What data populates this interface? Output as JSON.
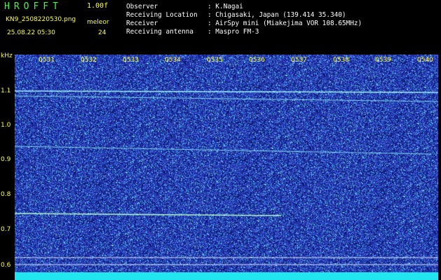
{
  "header": {
    "app_title": "HROFFT",
    "version": "1.00f",
    "filename": "KN9_2508220530.png",
    "datetime": "25.08.22 05:30",
    "mode_label": "meleor",
    "mode_value": "24",
    "info": [
      {
        "key": "Observer",
        "value": ": K.Nagai"
      },
      {
        "key": "Receiving Location",
        "value": ": Chigasaki, Japan (139.414 35.340)"
      },
      {
        "key": "Receiver",
        "value": ": AirSpy mini (Miakejima VOR 108.65MHz)"
      },
      {
        "key": "Receiving antenna",
        "value": ": Maspro FM-3"
      }
    ]
  },
  "spectrogram": {
    "y_unit": "kHz",
    "y_ticks": [
      "1.1",
      "1.0",
      "0.9",
      "0.8",
      "0.7",
      "0.6"
    ],
    "time_ticks": [
      "0531",
      "0532",
      "0533",
      "0534",
      "0535",
      "0536",
      "0537",
      "0538",
      "0539",
      "0540"
    ],
    "colors": {
      "background": "#1e2a8c",
      "label": "#ffff3c",
      "trace": "#9ff7ff",
      "band": "#21e6f0"
    }
  }
}
